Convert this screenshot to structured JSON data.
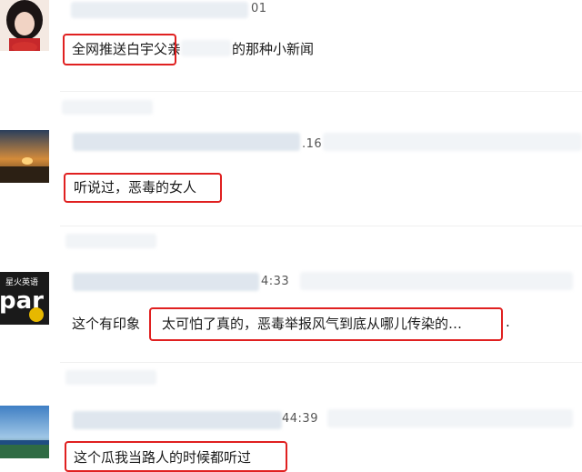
{
  "comments": [
    {
      "time_suffix": "01",
      "text": "全网推送白宇父亲",
      "text_tail": "的那种小新闻"
    },
    {
      "time_suffix": ".16",
      "text": "听说过，恶毒的女人"
    },
    {
      "time_suffix": "4:33",
      "avatar_label": "星火英语",
      "avatar_big": "par",
      "text_prefix": "这个有印象",
      "text": "太可怕了真的，恶毒举报风气到底从哪儿传染的…",
      "text_tail": "."
    },
    {
      "time_suffix": "44:39",
      "text": "这个瓜我当路人的时候都听过"
    }
  ],
  "colors": {
    "highlight_box": "#e02020",
    "blur": "#e9eef3"
  }
}
